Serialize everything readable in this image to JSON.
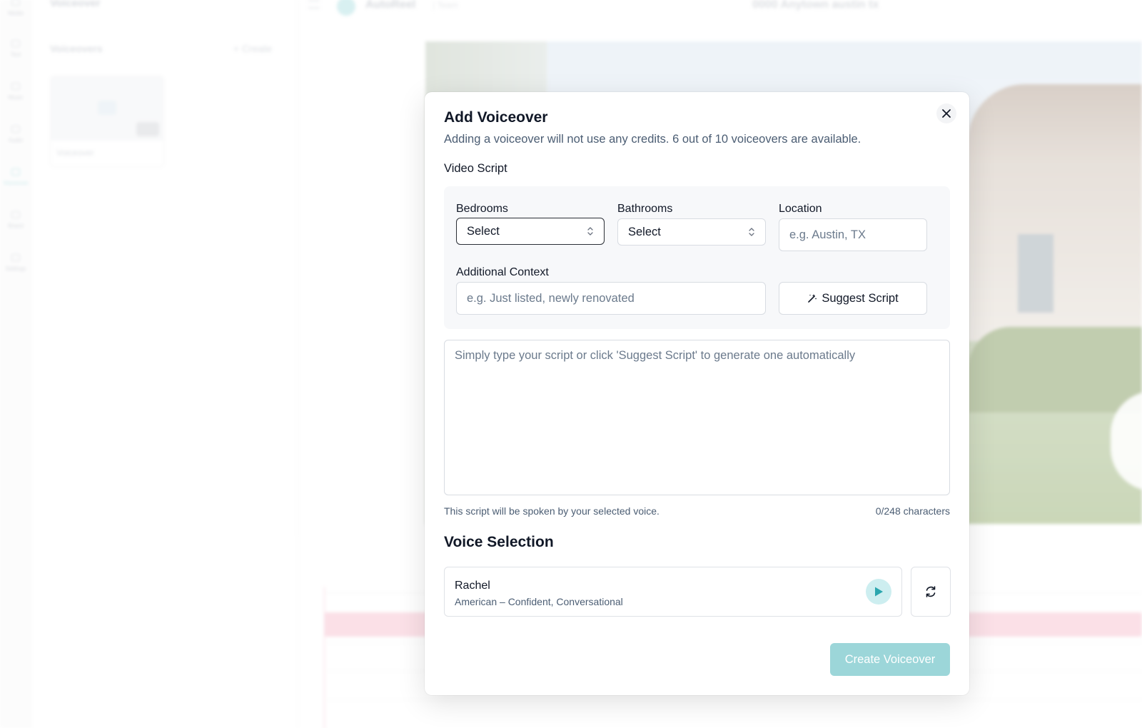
{
  "background": {
    "side_title": "Voiceover",
    "section_label": "Voiceovers",
    "create_label": "+ Create",
    "card_label": "Voiceover",
    "brand": "AutoReel",
    "plan": "| Team",
    "address": "0000 Anytown austin tx",
    "rail_labels": [
      "Media",
      "Text",
      "Music",
      "Audio",
      "Voiceover",
      "Brand",
      "Settings"
    ]
  },
  "modal": {
    "title": "Add Voiceover",
    "subtitle": "Adding a voiceover will not use any credits. 6 out of 10 voiceovers are available.",
    "video_script_label": "Video Script",
    "close_icon": "close-icon"
  },
  "script_form": {
    "bedrooms": {
      "label": "Bedrooms",
      "value": "Select"
    },
    "bathrooms": {
      "label": "Bathrooms",
      "value": "Select"
    },
    "location": {
      "label": "Location",
      "placeholder": "e.g. Austin, TX",
      "value": ""
    },
    "context": {
      "label": "Additional Context",
      "placeholder": "e.g. Just listed, newly renovated",
      "value": ""
    },
    "suggest_label": "Suggest Script",
    "suggest_icon": "magic-wand-icon",
    "script_placeholder": "Simply type your script or click 'Suggest Script' to generate one automatically",
    "script_value": "",
    "help_text": "This script will be spoken by your selected voice.",
    "char_count": "0/248 characters"
  },
  "voice": {
    "section_title": "Voice Selection",
    "name": "Rachel",
    "description": "American – Confident, Conversational",
    "play_icon": "play-icon",
    "refresh_icon": "refresh-icon"
  },
  "actions": {
    "create_label": "Create Voiceover"
  },
  "colors": {
    "accent": "#9cd6d9",
    "accent_dark": "#2aa6ae",
    "play_bg": "#cdeef0",
    "muted_text": "#4b5d73"
  }
}
